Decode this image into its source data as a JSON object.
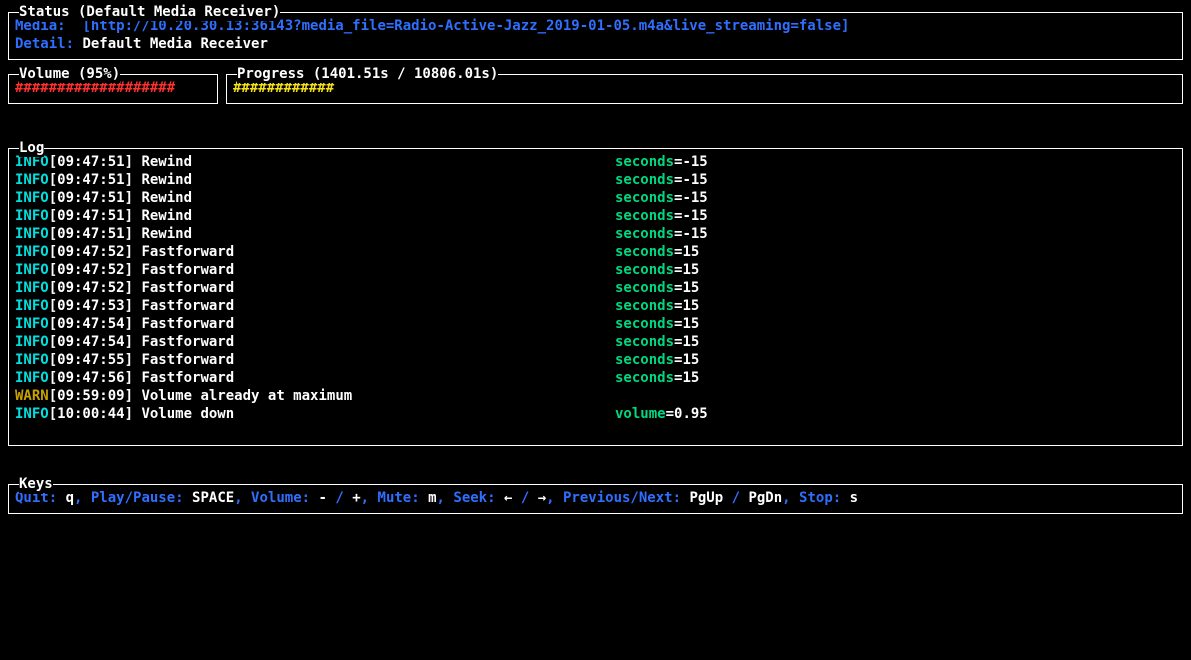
{
  "status": {
    "title": "Status (Default Media Receiver)",
    "media_label": "Media:  ",
    "media_value": "[http://10.20.30.13:36143?media_file=Radio-Active-Jazz_2019-01-05.m4a&live_streaming=false]",
    "detail_label": "Detail: ",
    "detail_value": "Default Media Receiver"
  },
  "volume": {
    "title": "Volume (95%)",
    "bar": "###################"
  },
  "progress": {
    "title": "Progress (1401.51s / 10806.01s)",
    "bar": "############"
  },
  "log": {
    "title": "Log",
    "entries": [
      {
        "level": "INFO",
        "ts": "[09:47:51]",
        "msg": "Rewind",
        "key": "seconds",
        "eq": "=",
        "val": "-15"
      },
      {
        "level": "INFO",
        "ts": "[09:47:51]",
        "msg": "Rewind",
        "key": "seconds",
        "eq": "=",
        "val": "-15"
      },
      {
        "level": "INFO",
        "ts": "[09:47:51]",
        "msg": "Rewind",
        "key": "seconds",
        "eq": "=",
        "val": "-15"
      },
      {
        "level": "INFO",
        "ts": "[09:47:51]",
        "msg": "Rewind",
        "key": "seconds",
        "eq": "=",
        "val": "-15"
      },
      {
        "level": "INFO",
        "ts": "[09:47:51]",
        "msg": "Rewind",
        "key": "seconds",
        "eq": "=",
        "val": "-15"
      },
      {
        "level": "INFO",
        "ts": "[09:47:52]",
        "msg": "Fastforward",
        "key": "seconds",
        "eq": "=",
        "val": "15"
      },
      {
        "level": "INFO",
        "ts": "[09:47:52]",
        "msg": "Fastforward",
        "key": "seconds",
        "eq": "=",
        "val": "15"
      },
      {
        "level": "INFO",
        "ts": "[09:47:52]",
        "msg": "Fastforward",
        "key": "seconds",
        "eq": "=",
        "val": "15"
      },
      {
        "level": "INFO",
        "ts": "[09:47:53]",
        "msg": "Fastforward",
        "key": "seconds",
        "eq": "=",
        "val": "15"
      },
      {
        "level": "INFO",
        "ts": "[09:47:54]",
        "msg": "Fastforward",
        "key": "seconds",
        "eq": "=",
        "val": "15"
      },
      {
        "level": "INFO",
        "ts": "[09:47:54]",
        "msg": "Fastforward",
        "key": "seconds",
        "eq": "=",
        "val": "15"
      },
      {
        "level": "INFO",
        "ts": "[09:47:55]",
        "msg": "Fastforward",
        "key": "seconds",
        "eq": "=",
        "val": "15"
      },
      {
        "level": "INFO",
        "ts": "[09:47:56]",
        "msg": "Fastforward",
        "key": "seconds",
        "eq": "=",
        "val": "15"
      },
      {
        "level": "WARN",
        "ts": "[09:59:09]",
        "msg": "Volume already at maximum",
        "key": "",
        "eq": "",
        "val": ""
      },
      {
        "level": "INFO",
        "ts": "[10:00:44]",
        "msg": "Volume down",
        "key": "volume",
        "eq": "=",
        "val": "0.95"
      }
    ]
  },
  "keys": {
    "title": "Keys",
    "quit_label": "Quit: ",
    "quit_key": "q",
    "sep": ", ",
    "play_label": "Play/Pause: ",
    "play_key": "SPACE",
    "vol_label": "Volume: ",
    "vol_minus": "-",
    "vol_slash": " / ",
    "vol_plus": "+",
    "mute_label": "Mute: ",
    "mute_key": "m",
    "seek_label": "Seek: ",
    "seek_left": "←",
    "seek_slash": " / ",
    "seek_right": "→",
    "pn_label": "Previous/Next: ",
    "pn_up": "PgUp",
    "pn_slash": " / ",
    "pn_dn": "PgDn",
    "stop_label": "Stop: ",
    "stop_key": "s"
  }
}
